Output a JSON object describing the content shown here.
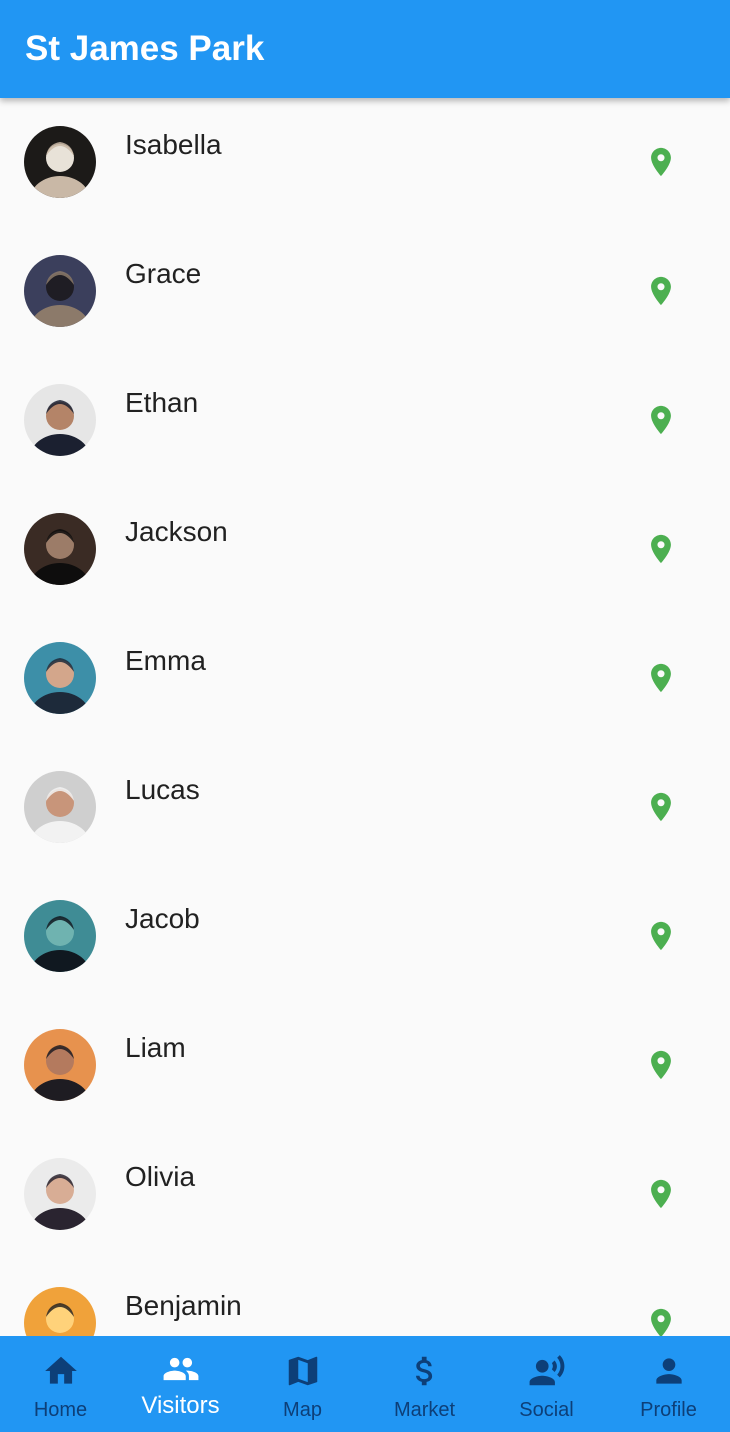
{
  "app": {
    "title": "St James Park"
  },
  "visitors": [
    {
      "name": "Isabella",
      "avatar_colors": [
        "#1c1a18",
        "#c9b8a6",
        "#e8e2d8"
      ]
    },
    {
      "name": "Grace",
      "avatar_colors": [
        "#3b3f5c",
        "#8c7a6a",
        "#1f1d24"
      ]
    },
    {
      "name": "Ethan",
      "avatar_colors": [
        "#e6e6e6",
        "#1b2030",
        "#b48468"
      ]
    },
    {
      "name": "Jackson",
      "avatar_colors": [
        "#3a2b24",
        "#0e0d0d",
        "#9c7c68"
      ]
    },
    {
      "name": "Emma",
      "avatar_colors": [
        "#3d8fa8",
        "#1d2a3a",
        "#d3a68b"
      ]
    },
    {
      "name": "Lucas",
      "avatar_colors": [
        "#cfcfcf",
        "#f2f2f2",
        "#c8957a"
      ]
    },
    {
      "name": "Jacob",
      "avatar_colors": [
        "#3f8c95",
        "#101820",
        "#6fb3b0"
      ]
    },
    {
      "name": "Liam",
      "avatar_colors": [
        "#e7924e",
        "#1e1c22",
        "#b47a5e"
      ]
    },
    {
      "name": "Olivia",
      "avatar_colors": [
        "#ebebeb",
        "#2a2430",
        "#d8ad95"
      ]
    },
    {
      "name": "Benjamin",
      "avatar_colors": [
        "#f0a23a",
        "#2a2520",
        "#ffd27a"
      ]
    }
  ],
  "colors": {
    "accent": "#2196f3",
    "pin": "#4caf50",
    "nav_inactive": "#0d3f78",
    "nav_active": "#ffffff"
  },
  "nav": {
    "items": [
      {
        "label": "Home",
        "icon": "home-icon"
      },
      {
        "label": "Visitors",
        "icon": "people-icon"
      },
      {
        "label": "Map",
        "icon": "map-icon"
      },
      {
        "label": "Market",
        "icon": "dollar-icon"
      },
      {
        "label": "Social",
        "icon": "social-icon"
      },
      {
        "label": "Profile",
        "icon": "person-icon"
      }
    ],
    "active": "Visitors"
  }
}
